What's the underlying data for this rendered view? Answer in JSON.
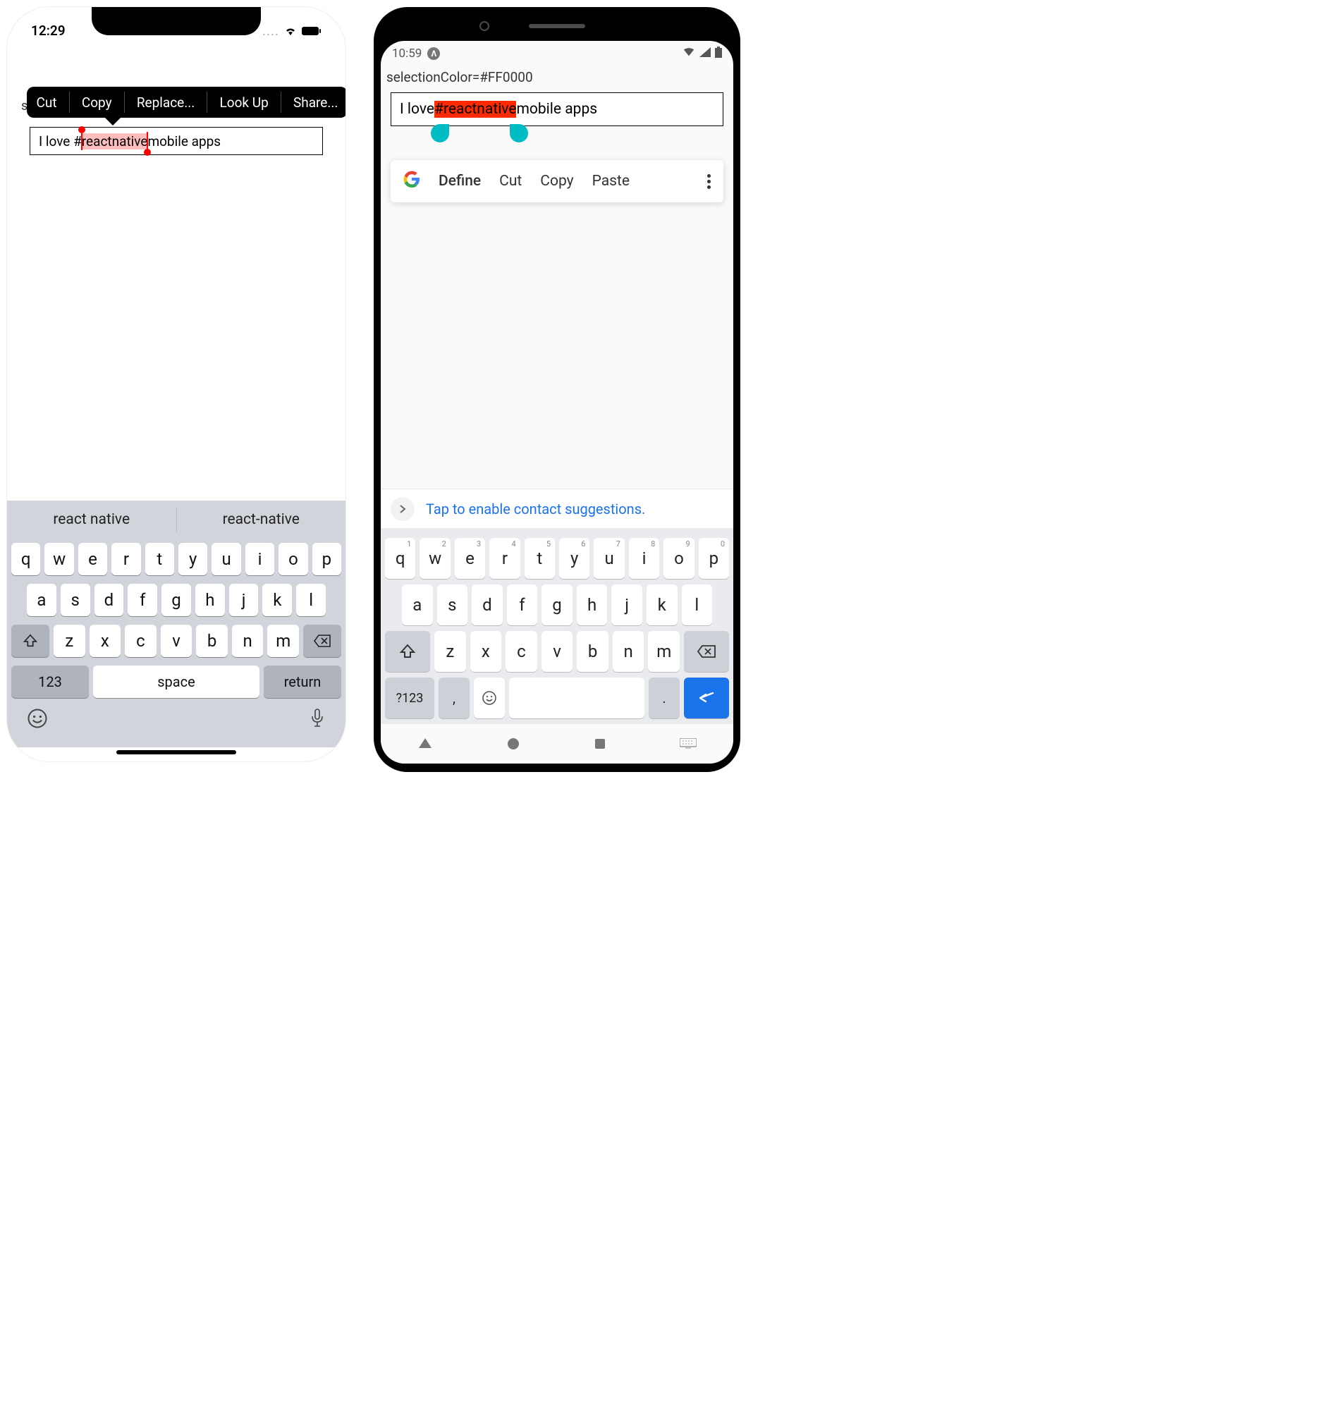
{
  "ios": {
    "status_time": "12:29",
    "label_truncated": "se",
    "context_menu": [
      "Cut",
      "Copy",
      "Replace...",
      "Look Up",
      "Share..."
    ],
    "input": {
      "before": "I love #",
      "selected": "reactnative",
      "after": " mobile apps"
    },
    "suggestions": [
      "react native",
      "react-native"
    ],
    "keyboard": {
      "row1": [
        "q",
        "w",
        "e",
        "r",
        "t",
        "y",
        "u",
        "i",
        "o",
        "p"
      ],
      "row2": [
        "a",
        "s",
        "d",
        "f",
        "g",
        "h",
        "j",
        "k",
        "l"
      ],
      "row3": [
        "z",
        "x",
        "c",
        "v",
        "b",
        "n",
        "m"
      ],
      "numbers_key": "123",
      "space_key": "space",
      "return_key": "return"
    }
  },
  "android": {
    "status_time": "10:59",
    "label": "selectionColor=#FF0000",
    "input": {
      "before": "I love ",
      "selected": "#reactnative",
      "after": " mobile apps"
    },
    "context_menu": [
      "Define",
      "Cut",
      "Copy",
      "Paste"
    ],
    "hint": "Tap to enable contact suggestions.",
    "keyboard": {
      "row1": [
        {
          "k": "q",
          "s": "1"
        },
        {
          "k": "w",
          "s": "2"
        },
        {
          "k": "e",
          "s": "3"
        },
        {
          "k": "r",
          "s": "4"
        },
        {
          "k": "t",
          "s": "5"
        },
        {
          "k": "y",
          "s": "6"
        },
        {
          "k": "u",
          "s": "7"
        },
        {
          "k": "i",
          "s": "8"
        },
        {
          "k": "o",
          "s": "9"
        },
        {
          "k": "p",
          "s": "0"
        }
      ],
      "row2": [
        "a",
        "s",
        "d",
        "f",
        "g",
        "h",
        "j",
        "k",
        "l"
      ],
      "row3": [
        "z",
        "x",
        "c",
        "v",
        "b",
        "n",
        "m"
      ],
      "symbols_key": "?123",
      "comma": ",",
      "period": "."
    }
  }
}
